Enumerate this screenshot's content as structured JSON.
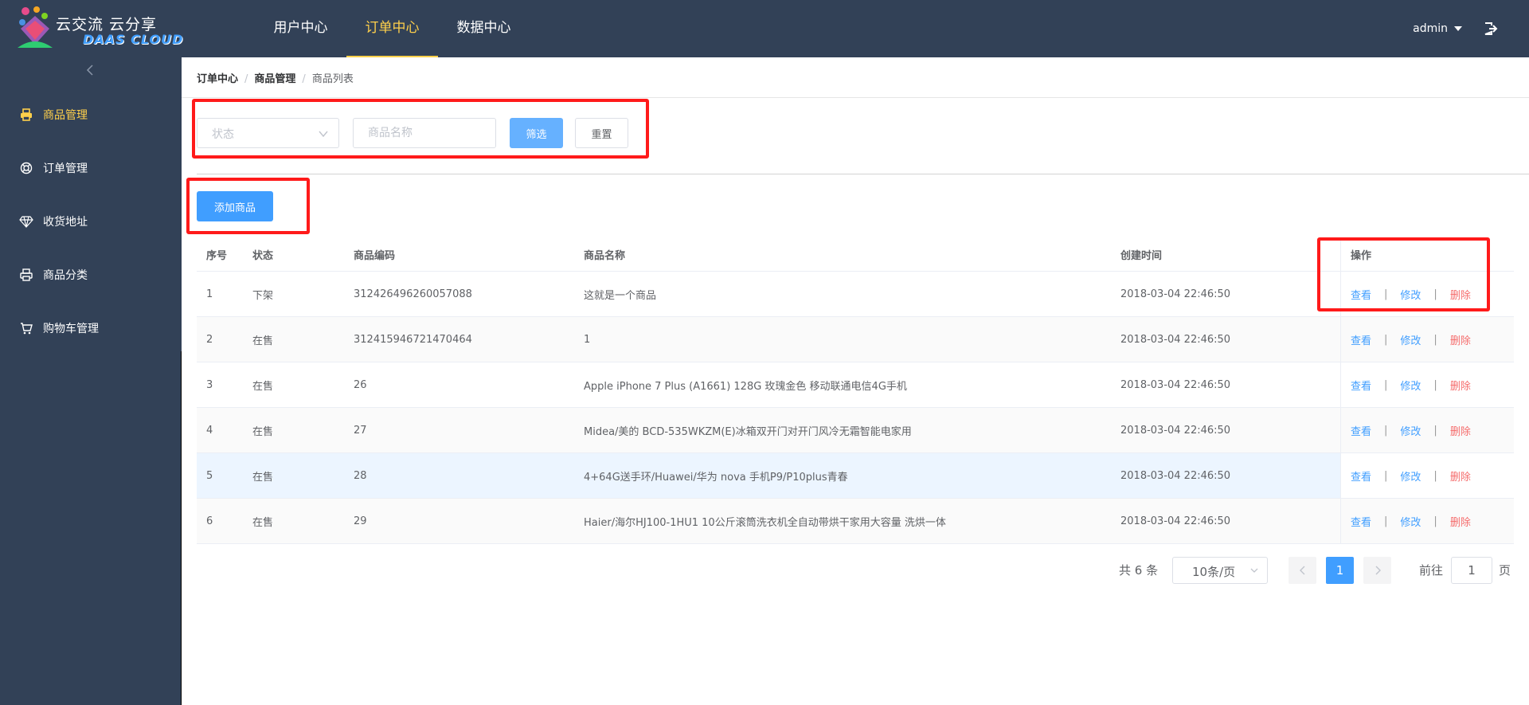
{
  "header": {
    "logo_cn": "云交流 云分享",
    "logo_en": "DAAS CLOUD",
    "nav": [
      "用户中心",
      "订单中心",
      "数据中心"
    ],
    "active_nav": 1,
    "user": "admin",
    "nav_active_color": "#ffd04b",
    "bg_color": "#324157"
  },
  "sidebar": {
    "items": [
      {
        "label": "商品管理",
        "icon": "printer-icon",
        "active": true
      },
      {
        "label": "订单管理",
        "icon": "lifebuoy-icon",
        "active": false
      },
      {
        "label": "收货地址",
        "icon": "diamond-icon",
        "active": false
      },
      {
        "label": "商品分类",
        "icon": "printer-icon",
        "active": false
      },
      {
        "label": "购物车管理",
        "icon": "cart-icon",
        "active": false
      }
    ]
  },
  "breadcrumb": [
    "订单中心",
    "商品管理",
    "商品列表"
  ],
  "filter": {
    "status_placeholder": "状态",
    "name_placeholder": "商品名称",
    "filter_label": "筛选",
    "reset_label": "重置"
  },
  "add_label": "添加商品",
  "table": {
    "headers": [
      "序号",
      "状态",
      "商品编码",
      "商品名称",
      "创建时间",
      "操作"
    ],
    "rows": [
      {
        "no": "1",
        "status": "下架",
        "code": "312426496260057088",
        "name": "这就是一个商品",
        "time": "2018-03-04 22:46:50"
      },
      {
        "no": "2",
        "status": "在售",
        "code": "312415946721470464",
        "name": "1",
        "time": "2018-03-04 22:46:50"
      },
      {
        "no": "3",
        "status": "在售",
        "code": "26",
        "name": "Apple iPhone 7 Plus (A1661) 128G 玫瑰金色 移动联通电信4G手机",
        "time": "2018-03-04 22:46:50"
      },
      {
        "no": "4",
        "status": "在售",
        "code": "27",
        "name": "Midea/美的 BCD-535WKZM(E)冰箱双开门对开门风冷无霜智能电家用",
        "time": "2018-03-04 22:46:50"
      },
      {
        "no": "5",
        "status": "在售",
        "code": "28",
        "name": "4+64G送手环/Huawei/华为 nova 手机P9/P10plus青春",
        "time": "2018-03-04 22:46:50"
      },
      {
        "no": "6",
        "status": "在售",
        "code": "29",
        "name": "Haier/海尔HJ100-1HU1 10公斤滚筒洗衣机全自动带烘干家用大容量 洗烘一体",
        "time": "2018-03-04 22:46:50"
      }
    ],
    "actions": {
      "view": "查看",
      "sep": "|",
      "edit": "修改",
      "del": "删除"
    }
  },
  "pagination": {
    "total": "共 6 条",
    "page_size": "10条/页",
    "current": "1",
    "goto_prefix": "前往",
    "goto_value": "1",
    "goto_suffix": "页"
  },
  "colors": {
    "primary": "#409eff",
    "danger": "#f56c6c",
    "annotation": "#ff1a1a"
  }
}
